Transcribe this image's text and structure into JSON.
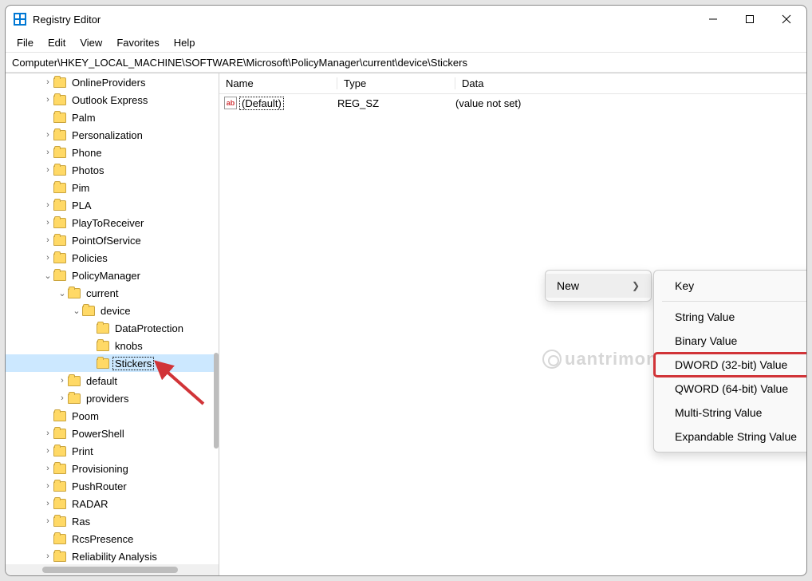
{
  "window": {
    "title": "Registry Editor"
  },
  "menu": {
    "file": "File",
    "edit": "Edit",
    "view": "View",
    "favorites": "Favorites",
    "help": "Help"
  },
  "address": "Computer\\HKEY_LOCAL_MACHINE\\SOFTWARE\\Microsoft\\PolicyManager\\current\\device\\Stickers",
  "columns": {
    "name": "Name",
    "type": "Type",
    "data": "Data"
  },
  "values": [
    {
      "name": "(Default)",
      "type": "REG_SZ",
      "data": "(value not set)"
    }
  ],
  "tree": [
    {
      "indent": 2,
      "chev": ">",
      "label": "OnlineProviders"
    },
    {
      "indent": 2,
      "chev": ">",
      "label": "Outlook Express"
    },
    {
      "indent": 2,
      "chev": "",
      "label": "Palm"
    },
    {
      "indent": 2,
      "chev": ">",
      "label": "Personalization"
    },
    {
      "indent": 2,
      "chev": ">",
      "label": "Phone"
    },
    {
      "indent": 2,
      "chev": ">",
      "label": "Photos"
    },
    {
      "indent": 2,
      "chev": "",
      "label": "Pim"
    },
    {
      "indent": 2,
      "chev": ">",
      "label": "PLA"
    },
    {
      "indent": 2,
      "chev": ">",
      "label": "PlayToReceiver"
    },
    {
      "indent": 2,
      "chev": ">",
      "label": "PointOfService"
    },
    {
      "indent": 2,
      "chev": ">",
      "label": "Policies"
    },
    {
      "indent": 2,
      "chev": "v",
      "label": "PolicyManager"
    },
    {
      "indent": 3,
      "chev": "v",
      "label": "current"
    },
    {
      "indent": 4,
      "chev": "v",
      "label": "device"
    },
    {
      "indent": 5,
      "chev": "",
      "label": "DataProtection"
    },
    {
      "indent": 5,
      "chev": "",
      "label": "knobs"
    },
    {
      "indent": 5,
      "chev": "",
      "label": "Stickers",
      "selected": true
    },
    {
      "indent": 3,
      "chev": ">",
      "label": "default"
    },
    {
      "indent": 3,
      "chev": ">",
      "label": "providers"
    },
    {
      "indent": 2,
      "chev": "",
      "label": "Poom"
    },
    {
      "indent": 2,
      "chev": ">",
      "label": "PowerShell"
    },
    {
      "indent": 2,
      "chev": ">",
      "label": "Print"
    },
    {
      "indent": 2,
      "chev": ">",
      "label": "Provisioning"
    },
    {
      "indent": 2,
      "chev": ">",
      "label": "PushRouter"
    },
    {
      "indent": 2,
      "chev": ">",
      "label": "RADAR"
    },
    {
      "indent": 2,
      "chev": ">",
      "label": "Ras"
    },
    {
      "indent": 2,
      "chev": "",
      "label": "RcsPresence"
    },
    {
      "indent": 2,
      "chev": ">",
      "label": "Reliability Analysis"
    }
  ],
  "context": {
    "new": "New",
    "sub": {
      "key": "Key",
      "string": "String Value",
      "binary": "Binary Value",
      "dword": "DWORD (32-bit) Value",
      "qword": "QWORD (64-bit) Value",
      "multi": "Multi-String Value",
      "expand": "Expandable String Value"
    }
  },
  "watermark": "uantrimon"
}
